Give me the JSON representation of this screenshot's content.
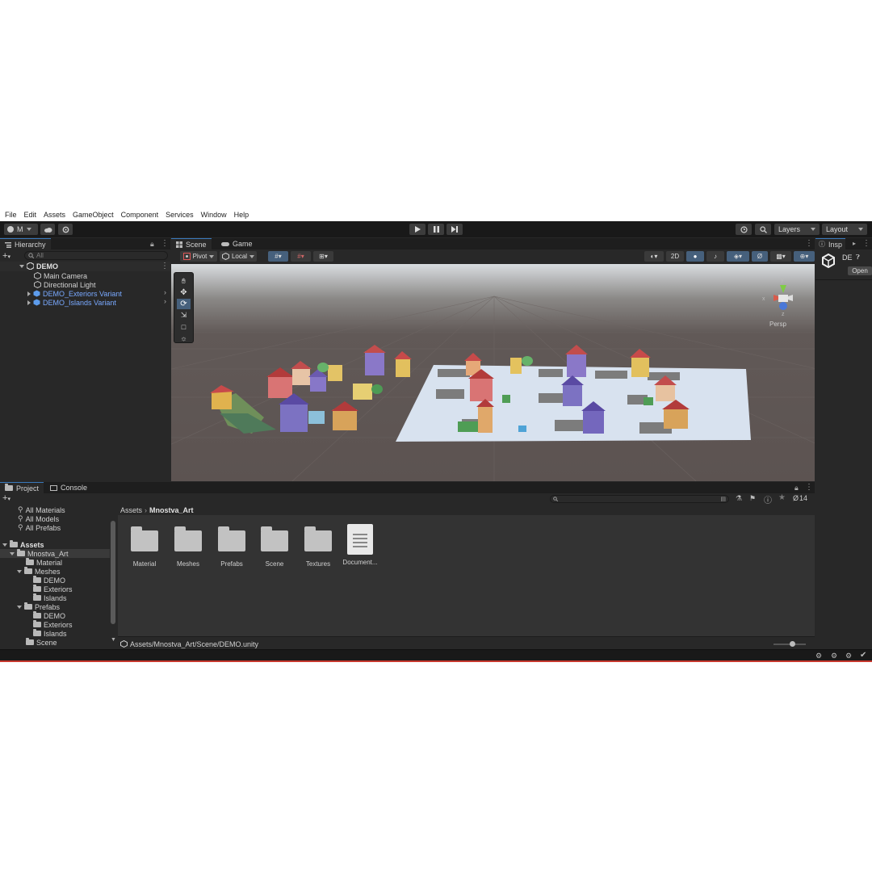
{
  "menubar": [
    "File",
    "Edit",
    "Assets",
    "GameObject",
    "Component",
    "Services",
    "Window",
    "Help"
  ],
  "toolbar": {
    "account_label": "M",
    "layers_label": "Layers",
    "layout_label": "Layout"
  },
  "hierarchy": {
    "tab": "Hierarchy",
    "search_placeholder": "All",
    "root": "DEMO",
    "items": [
      {
        "label": "Main Camera",
        "prefab": false
      },
      {
        "label": "Directional Light",
        "prefab": false
      },
      {
        "label": "DEMO_Exteriors Variant",
        "prefab": true
      },
      {
        "label": "DEMO_Islands Variant",
        "prefab": true
      }
    ]
  },
  "scene": {
    "tabs": [
      "Scene",
      "Game"
    ],
    "pivot": "Pivot",
    "local": "Local",
    "mode_2d": "2D",
    "gizmo": {
      "y": "y",
      "x": "x",
      "z": "z",
      "persp": "Persp"
    }
  },
  "inspector": {
    "tab": "Insp",
    "name": "DE",
    "open": "Open"
  },
  "project": {
    "tabs": [
      "Project",
      "Console"
    ],
    "favorites": [
      "All Materials",
      "All Models",
      "All Prefabs"
    ],
    "tree": [
      {
        "label": "Assets",
        "depth": 0,
        "bold": true
      },
      {
        "label": "Mnostva_Art",
        "depth": 1,
        "selected": true
      },
      {
        "label": "Material",
        "depth": 2
      },
      {
        "label": "Meshes",
        "depth": 2
      },
      {
        "label": "DEMO",
        "depth": 3
      },
      {
        "label": "Exteriors",
        "depth": 3
      },
      {
        "label": "Islands",
        "depth": 3
      },
      {
        "label": "Prefabs",
        "depth": 2
      },
      {
        "label": "DEMO",
        "depth": 3
      },
      {
        "label": "Exteriors",
        "depth": 3
      },
      {
        "label": "Islands",
        "depth": 3
      },
      {
        "label": "Scene",
        "depth": 2
      }
    ],
    "breadcrumb": [
      "Assets",
      "Mnostva_Art"
    ],
    "assets": [
      "Material",
      "Meshes",
      "Prefabs",
      "Scene",
      "Textures",
      "Document..."
    ],
    "hidden_count": "14",
    "footer_path": "Assets/Mnostva_Art/Scene/DEMO.unity"
  }
}
